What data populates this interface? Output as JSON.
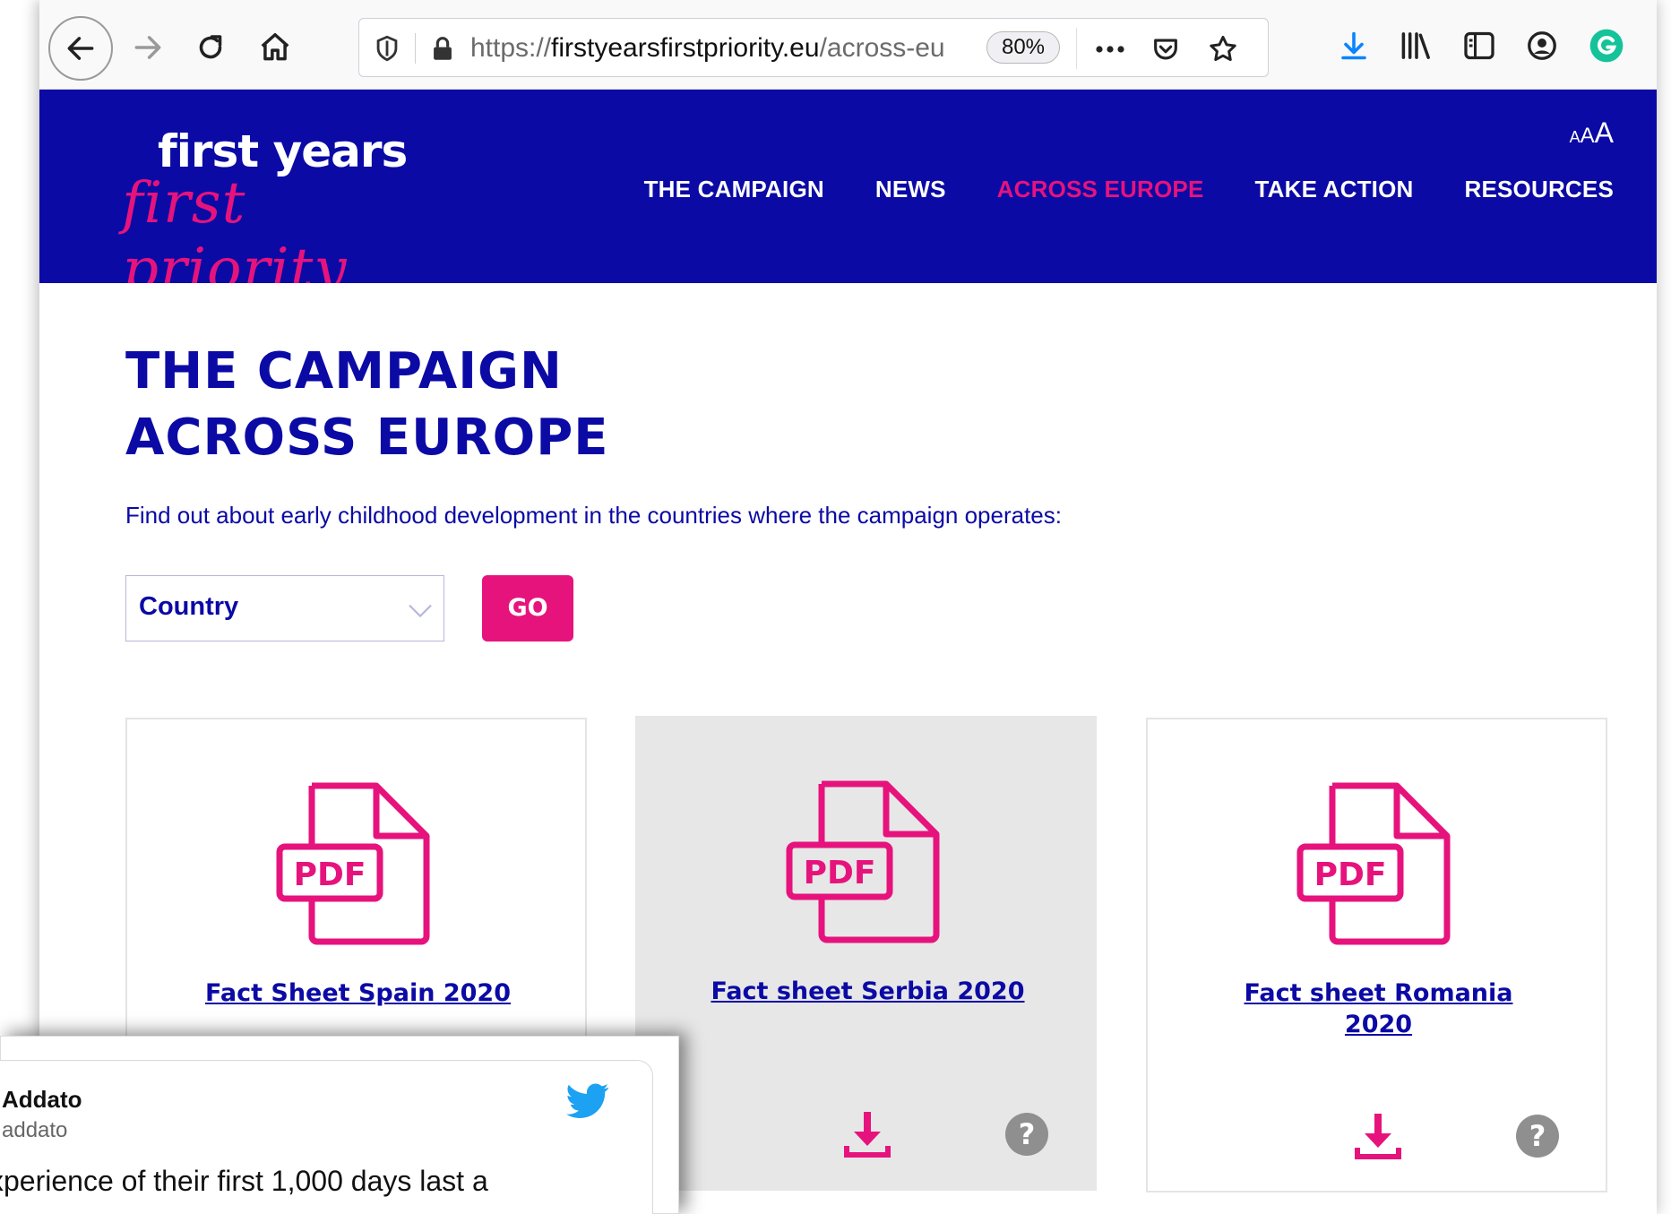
{
  "browser": {
    "url_prefix": "https://",
    "url_domain": "firstyearsfirstpriority.eu",
    "url_path": "/across-eu",
    "zoom": "80%",
    "accent_color": "#0a84ff",
    "grammarly_color": "#15c39a"
  },
  "site": {
    "logo_line1": "first years",
    "logo_line2": "first priority",
    "text_size_small": "A",
    "text_size_medium": "A",
    "text_size_large": "A",
    "nav": [
      {
        "label": "THE CAMPAIGN"
      },
      {
        "label": "NEWS"
      },
      {
        "label": "ACROSS EUROPE"
      },
      {
        "label": "TAKE ACTION"
      },
      {
        "label": "RESOURCES"
      }
    ],
    "brand_blue": "#0b0aa5",
    "brand_pink": "#e6137d"
  },
  "main": {
    "title_line1": "THE CAMPAIGN",
    "title_line2": "ACROSS EUROPE",
    "intro": "Find out about early childhood development in the countries where the campaign operates:",
    "country_select": "Country",
    "go_label": "GO",
    "cards": [
      {
        "title_line1": "Fact Sheet Spain 2020",
        "title_line2": "",
        "pdf_label": "PDF"
      },
      {
        "title_line1": "Fact sheet Serbia 2020",
        "title_line2": "",
        "pdf_label": "PDF"
      },
      {
        "title_line1": "Fact sheet Romania",
        "title_line2": "2020",
        "pdf_label": "PDF"
      }
    ]
  },
  "tweet": {
    "name": "Addato",
    "handle": "addato",
    "text": "xperience of their first 1,000 days last a"
  }
}
